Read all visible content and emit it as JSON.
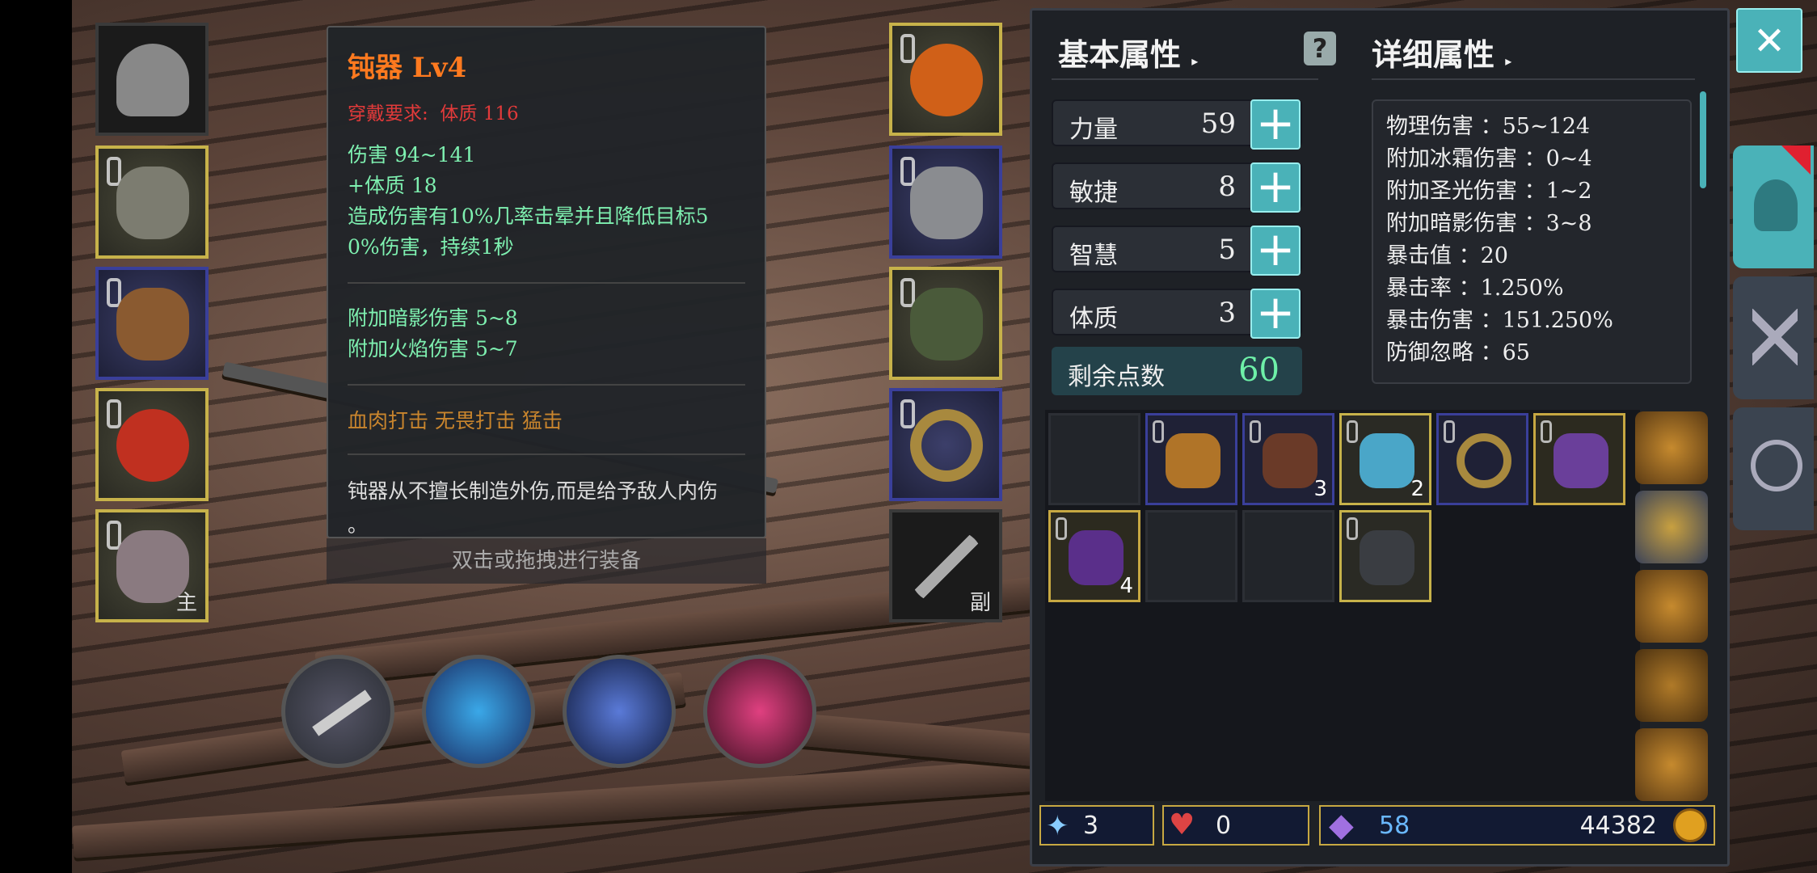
{
  "equip_left": [
    {
      "name": "helmet",
      "border": "grey",
      "tag": ""
    },
    {
      "name": "armor",
      "border": "gold",
      "tag": ""
    },
    {
      "name": "belt",
      "border": "blue",
      "tag": ""
    },
    {
      "name": "ring",
      "border": "gold",
      "tag": ""
    },
    {
      "name": "axe",
      "border": "gold",
      "tag": "主"
    }
  ],
  "equip_right": [
    {
      "name": "necklace",
      "border": "gold",
      "tag": ""
    },
    {
      "name": "gauntlet",
      "border": "blue",
      "tag": ""
    },
    {
      "name": "boots",
      "border": "gold",
      "tag": ""
    },
    {
      "name": "bracelet",
      "border": "blue",
      "tag": ""
    },
    {
      "name": "offhand",
      "border": "grey",
      "tag": "副"
    }
  ],
  "tooltip": {
    "title": "钝器 Lv4",
    "requirement_label": "穿戴要求:",
    "requirement_value": "体质 116",
    "line1": "伤害 94~141",
    "line2": "+体质 18",
    "line3": "造成伤害有10%几率击晕并且降低目标5",
    "line4": "0%伤害，持续1秒",
    "extra1": "附加暗影伤害 5~8",
    "extra2": "附加火焰伤害 5~7",
    "skills": "血肉打击 无畏打击 猛击",
    "desc1": "钝器从不擅长制造外伤,而是给予敌人内伤",
    "desc2": "。"
  },
  "hint": "双击或拖拽进行装备",
  "panel": {
    "basic_title": "基本属性",
    "detail_title": "详细属性",
    "stats": [
      {
        "label": "力量",
        "value": "59"
      },
      {
        "label": "敏捷",
        "value": "8"
      },
      {
        "label": "智慧",
        "value": "5"
      },
      {
        "label": "体质",
        "value": "3"
      }
    ],
    "remain_label": "剩余点数",
    "remain_value": "60",
    "details": [
      "物理伤害 ：55~124",
      "附加冰霜伤害 ：0~4",
      "附加圣光伤害 ：1~2",
      "附加暗影伤害 ：3~8",
      "暴击值 ：20",
      "暴击率 ：1.250%",
      "暴击伤害 ：151.250%",
      "防御忽略 ：65"
    ]
  },
  "inventory": [
    {
      "name": "empty",
      "border": "none",
      "count": "",
      "color": ""
    },
    {
      "name": "backpack",
      "border": "blue",
      "count": "",
      "color": "#b07428"
    },
    {
      "name": "feather",
      "border": "blue",
      "count": "3",
      "color": "#6a3a28"
    },
    {
      "name": "scroll",
      "border": "gold",
      "count": "2",
      "color": "#4aa6c8"
    },
    {
      "name": "ring",
      "border": "blue",
      "count": "",
      "color": "#a8893e"
    },
    {
      "name": "dagger",
      "border": "gold",
      "count": "",
      "color": "#6a3f9a"
    },
    {
      "name": "rune",
      "border": "gold",
      "count": "4",
      "color": "#5a2f8a"
    },
    {
      "name": "empty",
      "border": "none",
      "count": "",
      "color": ""
    },
    {
      "name": "empty",
      "border": "none",
      "count": "",
      "color": ""
    },
    {
      "name": "glove",
      "border": "gold",
      "count": "",
      "color": "#3a3d42"
    }
  ],
  "currency": {
    "wand": "3",
    "heart": "0",
    "gem": "58",
    "gold": "44382"
  },
  "close_symbol": "✕",
  "plus_symbol": "+"
}
